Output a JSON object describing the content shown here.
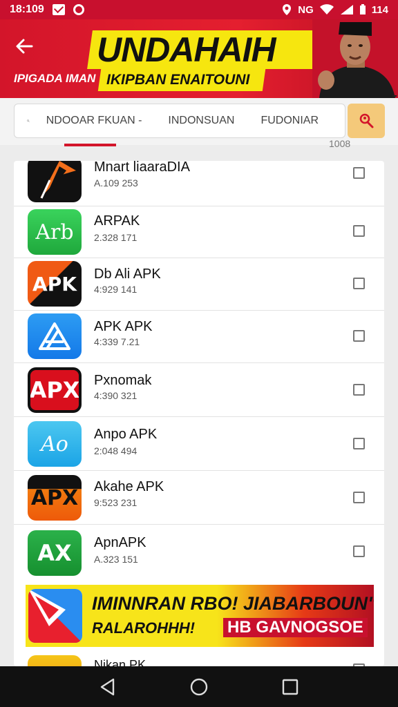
{
  "status": {
    "time": "18:109",
    "carrier": "NG",
    "battery": "114"
  },
  "banner": {
    "title": "UNDAHAIH",
    "sub_left": "IPIGADA IMAN",
    "subtitle": "IKIPBAN ENAITOUNI"
  },
  "search": {
    "segments": [
      "NDOOAR FKUAN -",
      "INDONSUAN",
      "FUDONIAR"
    ]
  },
  "list_header_count": "1008",
  "apps": [
    {
      "name": "Mnart liaaraDIA",
      "version": "A.109 253",
      "icon_text": "",
      "icon": "arrow-play-app-icon"
    },
    {
      "name": "ARPAK",
      "version": "2.328 171",
      "icon_text": "Arb",
      "icon": "arb-app-icon"
    },
    {
      "name": "Db Ali APK",
      "version": "4:929 141",
      "icon_text": "APK",
      "icon": "apk-app-icon"
    },
    {
      "name": "APK APK",
      "version": "4:339 7.21",
      "icon_text": "",
      "icon": "a-logo-app-icon"
    },
    {
      "name": "Pxnomak",
      "version": "4:390 321",
      "icon_text": "APX",
      "icon": "apx-red-app-icon"
    },
    {
      "name": "Anpo APK",
      "version": "2:048 494",
      "icon_text": "Ao",
      "icon": "ao-app-icon"
    },
    {
      "name": "Akahe APK",
      "version": "9:523 231",
      "icon_text": "APX",
      "icon": "apx-orange-app-icon"
    },
    {
      "name": "ApnAPK",
      "version": "A.323 151",
      "icon_text": "AX",
      "icon": "ax-green-app-icon"
    }
  ],
  "ad": {
    "line1": "IMINNRAN RBO! JIABARBOUN\"",
    "line2": "RALAROHHH!",
    "line2b": "HB GAVNOGSOE"
  },
  "peek_app": {
    "name": "Nikan PK"
  },
  "colors": {
    "brand_red": "#c8102e",
    "accent_yellow": "#f6e60f",
    "search_button": "#f4c97a"
  }
}
